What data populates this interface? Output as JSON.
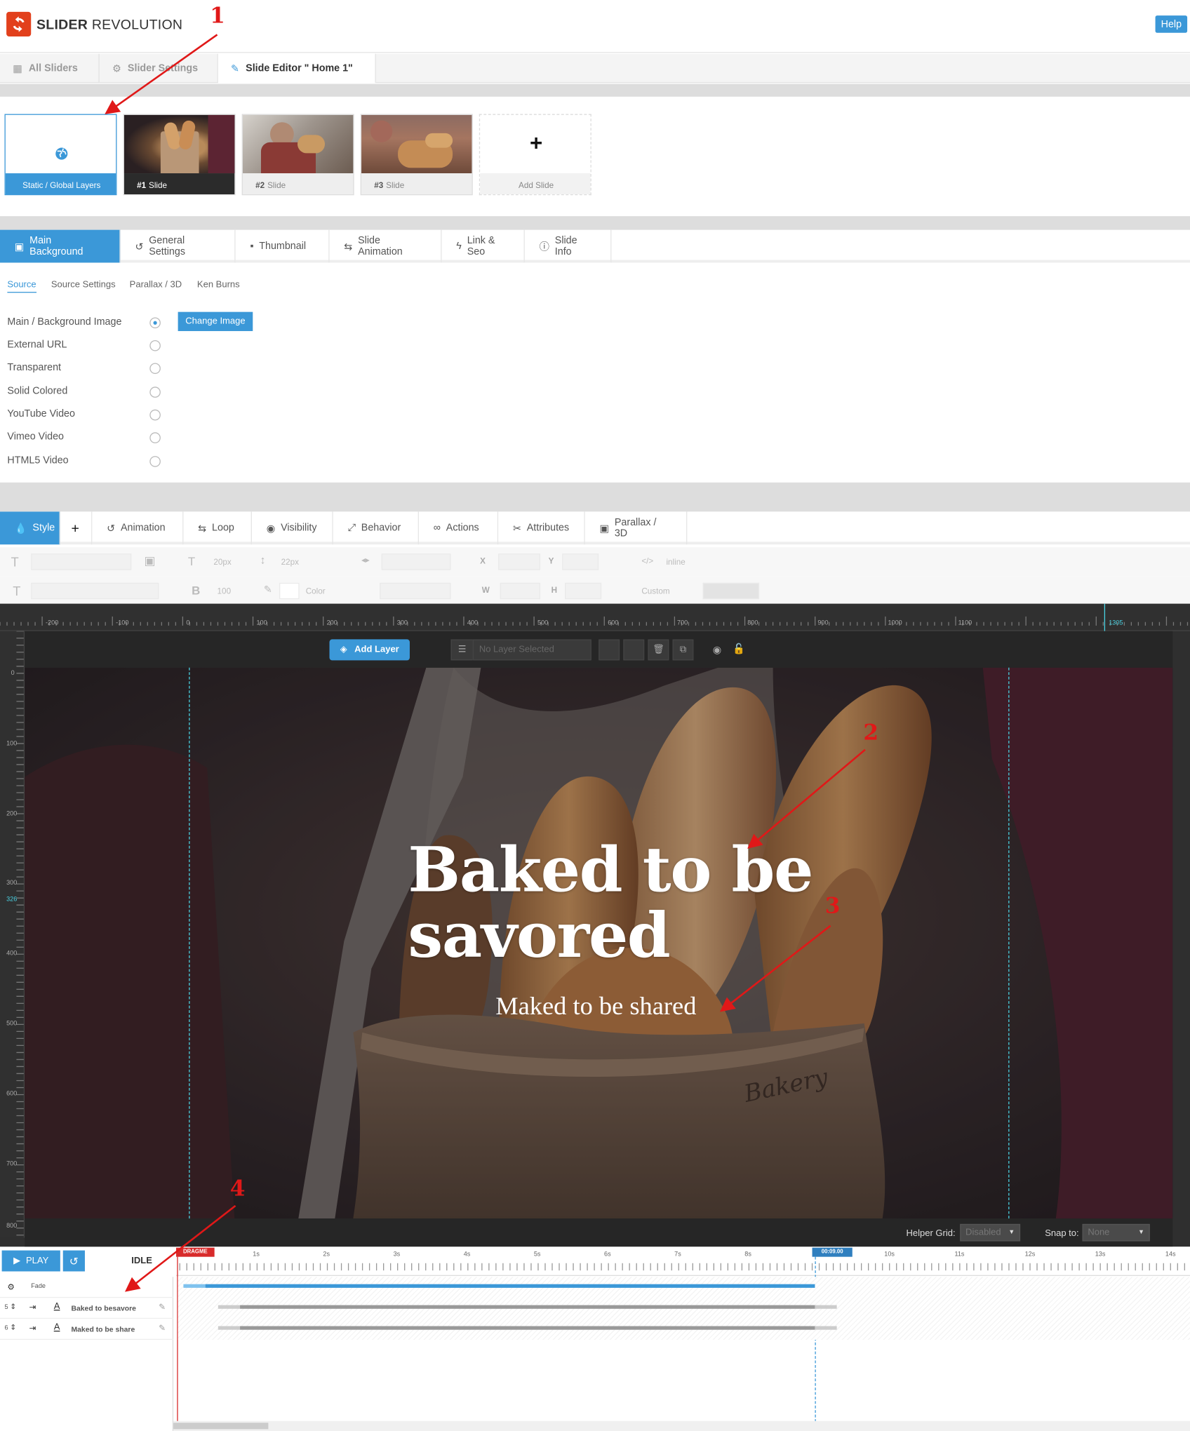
{
  "app": {
    "logo_bold": "SLIDER",
    "logo_rest": " REVOLUTION",
    "help": "Help"
  },
  "nav": {
    "tabs": [
      {
        "label": "All Sliders",
        "icon": "grid-icon"
      },
      {
        "label": "Slider Settings",
        "icon": "gear-icon"
      },
      {
        "label": "Slide Editor \" Home 1\"",
        "icon": "pencil-icon"
      }
    ]
  },
  "slides": {
    "global_label": "Static / Global Layers",
    "items": [
      {
        "num": "#1",
        "label": "Slide"
      },
      {
        "num": "#2",
        "label": "Slide"
      },
      {
        "num": "#3",
        "label": "Slide"
      }
    ],
    "add_label": "Add Slide",
    "add_symbol": "+"
  },
  "slide_tabs": [
    "Main Background",
    "General Settings",
    "Thumbnail",
    "Slide Animation",
    "Link & Seo",
    "Slide Info"
  ],
  "source_tabs": [
    "Source",
    "Source Settings",
    "Parallax / 3D",
    "Ken Burns"
  ],
  "source_options": [
    "Main / Background Image",
    "External URL",
    "Transparent",
    "Solid Colored",
    "YouTube Video",
    "Vimeo Video",
    "HTML5 Video"
  ],
  "change_image": "Change Image",
  "layer_tabs": [
    "Style",
    "+",
    "Animation",
    "Loop",
    "Visibility",
    "Behavior",
    "Actions",
    "Attributes",
    "Parallax / 3D"
  ],
  "toolbar": {
    "font_size": "20px",
    "line_height": "22px",
    "x": "X",
    "y": "Y",
    "w": "W",
    "h": "H",
    "weight": "100",
    "color": "Color",
    "inline": "inline",
    "custom": "Custom"
  },
  "ruler": {
    "h_labels": [
      "-200",
      "-100",
      "0",
      "100",
      "200",
      "300",
      "400",
      "500",
      "600",
      "700",
      "800",
      "900",
      "1000",
      "1100",
      "1305"
    ],
    "v_labels": [
      "0",
      "100",
      "200",
      "300",
      "326",
      "400",
      "500",
      "600",
      "700",
      "800"
    ]
  },
  "editor": {
    "add_layer": "Add Layer",
    "no_layer": "No Layer Selected",
    "headline_1": "Baked to be",
    "headline_2": "savored",
    "subline": "Maked to be shared",
    "bag_text": "Bakery",
    "helper_grid_label": "Helper Grid:",
    "helper_grid_value": "Disabled",
    "snap_label": "Snap to:",
    "snap_value": "None"
  },
  "timeline": {
    "play": "PLAY",
    "state": "IDLE",
    "dragme": "DRAGME",
    "time_marker": "00:09.00",
    "ticks": [
      "1s",
      "2s",
      "3s",
      "4s",
      "5s",
      "6s",
      "7s",
      "8s",
      "10s",
      "11s",
      "12s",
      "13s",
      "14s"
    ],
    "rows": [
      {
        "label": "Fade"
      },
      {
        "num": "5",
        "label": "Baked to besavore"
      },
      {
        "num": "6",
        "label": "Maked to be share"
      }
    ]
  },
  "annotations": [
    "1",
    "2",
    "3",
    "4"
  ],
  "colors": {
    "accent": "#3b98d8",
    "logo": "#e2401c",
    "annotation": "#e01818",
    "guide": "#49d2e3"
  }
}
